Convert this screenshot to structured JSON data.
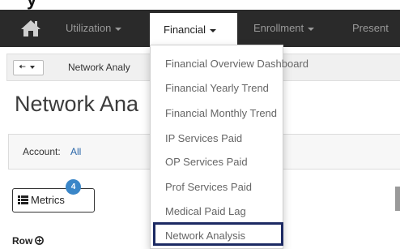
{
  "nav": {
    "items": [
      {
        "label": "Utilization"
      },
      {
        "label": "Financial"
      },
      {
        "label": "Enrollment"
      },
      {
        "label": "Present"
      }
    ],
    "active_index": 1
  },
  "breadcrumb": {
    "label": "Network Analy"
  },
  "page": {
    "title": "Network Ana"
  },
  "account": {
    "label": "Account:",
    "value": "All"
  },
  "metrics": {
    "label": "Metrics",
    "badge": "4"
  },
  "row": {
    "label": "Row"
  },
  "dropdown": {
    "items": [
      {
        "label": "Financial Overview Dashboard"
      },
      {
        "label": "Financial Yearly Trend"
      },
      {
        "label": "Financial Monthly Trend"
      },
      {
        "label": "IP Services Paid"
      },
      {
        "label": "OP Services Paid"
      },
      {
        "label": "Prof Services Paid"
      },
      {
        "label": "Medical Paid Lag"
      },
      {
        "label": "Network Analysis"
      }
    ],
    "highlighted_index": 7
  },
  "colors": {
    "navbar": "#2a2a2a",
    "link_blue": "#2a66a8",
    "badge_blue": "#3a86c8",
    "highlight_border": "#1c2a63"
  },
  "icons": {
    "home": "home-icon",
    "back": "arrow-left-icon",
    "metrics": "list-icon",
    "row": "plus-circle-icon"
  }
}
